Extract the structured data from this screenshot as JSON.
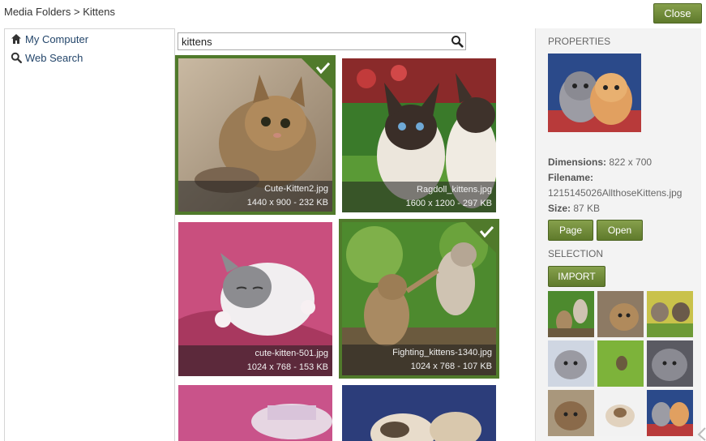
{
  "breadcrumb": {
    "root": "Media Folders",
    "separator": ">",
    "current": "Kittens"
  },
  "close_button": {
    "label": "Close"
  },
  "nav": {
    "items": [
      {
        "label": "My Computer",
        "icon": "home-icon"
      },
      {
        "label": "Web Search",
        "icon": "search-icon"
      }
    ]
  },
  "search": {
    "value": "kittens",
    "icon": "search-icon"
  },
  "results": [
    {
      "name": "Cute-Kitten2.jpg",
      "meta": "1440 x 900 - 232 KB",
      "selected": true
    },
    {
      "name": "Ragdoll_kittens.jpg",
      "meta": "1600 x 1200 - 297 KB",
      "selected": false
    },
    {
      "name": "cute-kitten-501.jpg",
      "meta": "1024 x 768 - 153 KB",
      "selected": false
    },
    {
      "name": "Fighting_kittens-1340.jpg",
      "meta": "1024 x 768 - 107 KB",
      "selected": true
    }
  ],
  "properties": {
    "title": "PROPERTIES",
    "dimensions_label": "Dimensions:",
    "dimensions_value": "822 x 700",
    "filename_label": "Filename:",
    "filename_value": "1215145026AllthoseKittens.jpg",
    "size_label": "Size:",
    "size_value": "87 KB",
    "page_button": "Page",
    "open_button": "Open"
  },
  "selection": {
    "title": "SELECTION",
    "import_button": "IMPORT",
    "thumbnail_count": 9
  },
  "colors": {
    "accent_green": "#5f7a2c",
    "selected_border": "#507a2b",
    "link_blue": "#24466b",
    "panel_bg": "#f3f3f3"
  }
}
